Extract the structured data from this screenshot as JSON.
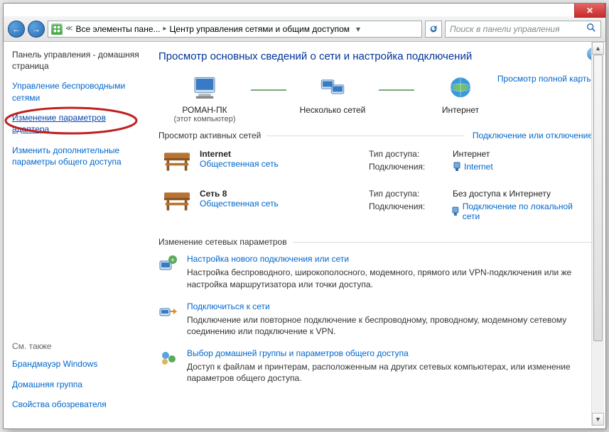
{
  "titlebar": {
    "close": "✕"
  },
  "nav": {
    "back": "←",
    "fwd": "→",
    "crumb1": "Все элементы пане...",
    "crumb2": "Центр управления сетями и общим доступом",
    "refresh": "↻"
  },
  "search": {
    "placeholder": "Поиск в панели управления",
    "icon": "🔍"
  },
  "sidebar": {
    "home": "Панель управления - домашняя страница",
    "wireless": "Управление беспроводными сетями",
    "adapter": "Изменение параметров адаптера",
    "sharing": "Изменить дополнительные параметры общего доступа",
    "see_also": "См. также",
    "firewall": "Брандмауэр Windows",
    "homegroup": "Домашняя группа",
    "inetopts": "Свойства обозревателя"
  },
  "main": {
    "help": "?",
    "h1": "Просмотр основных сведений о сети и настройка подключений",
    "map_full": "Просмотр полной карты",
    "node_pc": "РОМАН-ПК",
    "node_pc_sub": "(этот компьютер)",
    "node_multi": "Несколько сетей",
    "node_inet": "Интернет",
    "active_head": "Просмотр активных сетей",
    "active_link": "Подключение или отключение",
    "nets": [
      {
        "name": "Internet",
        "type": "Общественная сеть",
        "access_lbl": "Тип доступа:",
        "access_val": "Интернет",
        "conn_lbl": "Подключения:",
        "conn_val": "Internet"
      },
      {
        "name": "Сеть  8",
        "type": "Общественная сеть",
        "access_lbl": "Тип доступа:",
        "access_val": "Без доступа к Интернету",
        "conn_lbl": "Подключения:",
        "conn_val": "Подключение по локальной сети"
      }
    ],
    "change_head": "Изменение сетевых параметров",
    "tasks": [
      {
        "title": "Настройка нового подключения или сети",
        "desc": "Настройка беспроводного, широкополосного, модемного, прямого или VPN-подключения или же настройка маршрутизатора или точки доступа."
      },
      {
        "title": "Подключиться к сети",
        "desc": "Подключение или повторное подключение к беспроводному, проводному, модемному сетевому соединению или подключение к VPN."
      },
      {
        "title": "Выбор домашней группы и параметров общего доступа",
        "desc": "Доступ к файлам и принтерам, расположенным на других сетевых компьютерах, или изменение параметров общего доступа."
      }
    ]
  }
}
